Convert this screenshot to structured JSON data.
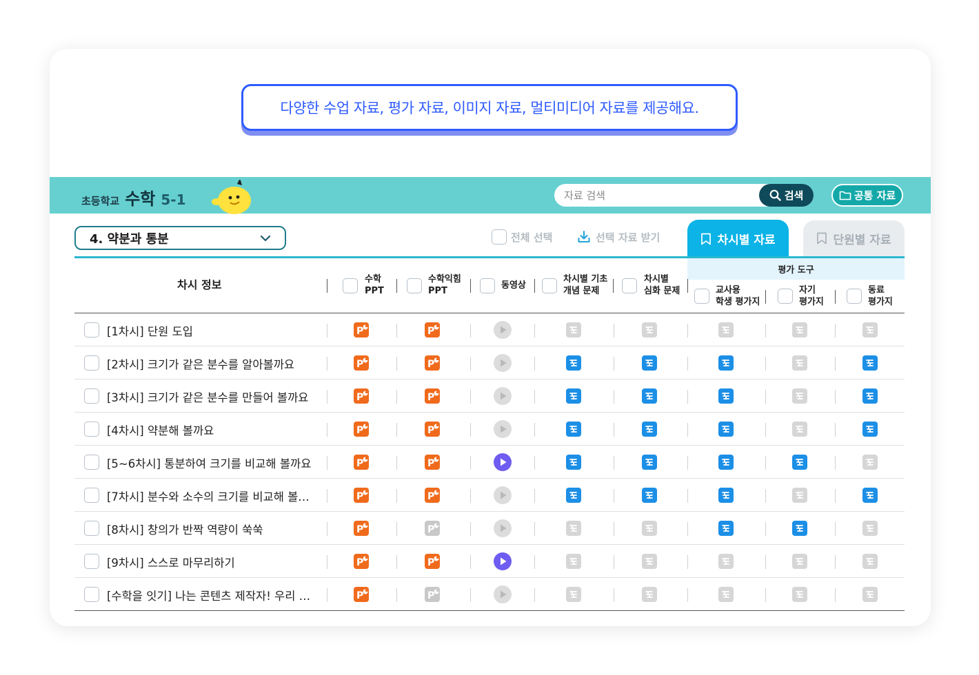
{
  "banner": {
    "text": "다양한 수업 자료, 평가 자료, 이미지 자료, 멀티미디어 자료를 제공해요."
  },
  "header": {
    "school": "초등학교",
    "subject": "수학",
    "grade": "5-1"
  },
  "search": {
    "placeholder": "자료 검색",
    "button": "검색"
  },
  "common_button": "공통 자료",
  "unit_select": {
    "value": "4. 약분과 통분"
  },
  "actions": {
    "select_all": "전체 선택",
    "download": "선택 자료 받기"
  },
  "tabs": {
    "active": "차시별 자료",
    "inactive": "단원별 자료"
  },
  "table": {
    "info_header": "차시 정보",
    "eval_group": "평가 도구",
    "columns": [
      {
        "l1": "수학",
        "l2": "PPT"
      },
      {
        "l1": "수학익힘",
        "l2": "PPT"
      },
      {
        "l1": "동영상",
        "l2": ""
      },
      {
        "l1": "차시별 기초",
        "l2": "개념 문제"
      },
      {
        "l1": "차시별",
        "l2": "심화 문제"
      },
      {
        "l1": "교사용",
        "l2": "학생 평가지"
      },
      {
        "l1": "자기",
        "l2": "평가지"
      },
      {
        "l1": "동료",
        "l2": "평가지"
      }
    ],
    "rows": [
      {
        "title": "[1차시] 단원 도입",
        "avail": [
          1,
          1,
          0,
          0,
          0,
          0,
          0,
          0
        ]
      },
      {
        "title": "[2차시] 크기가 같은 분수를 알아볼까요",
        "avail": [
          1,
          1,
          0,
          1,
          1,
          1,
          0,
          1
        ]
      },
      {
        "title": "[3차시] 크기가 같은 분수를 만들어 볼까요",
        "avail": [
          1,
          1,
          0,
          1,
          1,
          1,
          0,
          1
        ]
      },
      {
        "title": "[4차시] 약분해 볼까요",
        "avail": [
          1,
          1,
          0,
          1,
          1,
          1,
          0,
          1
        ]
      },
      {
        "title": "[5~6차시] 통분하여 크기를 비교해 볼까요",
        "avail": [
          1,
          1,
          1,
          1,
          1,
          1,
          1,
          0
        ]
      },
      {
        "title": "[7차시] 분수와 소수의 크기를 비교해 볼…",
        "avail": [
          1,
          1,
          0,
          1,
          1,
          1,
          0,
          1
        ]
      },
      {
        "title": "[8차시] 창의가 반짝 역량이 쑥쑥",
        "avail": [
          1,
          0,
          0,
          0,
          0,
          1,
          1,
          0
        ]
      },
      {
        "title": "[9차시] 스스로 마무리하기",
        "avail": [
          1,
          1,
          1,
          0,
          0,
          0,
          0,
          0
        ]
      },
      {
        "title": "[수학을 잇기] 나는 콘텐츠 제작자! 우리 …",
        "avail": [
          1,
          0,
          0,
          0,
          0,
          0,
          0,
          0
        ]
      }
    ]
  },
  "colors": {
    "teal_bar": "#66d0d0",
    "active_tab": "#0bb3e6",
    "ppt": "#f06a1c",
    "video": "#6f5cf0",
    "doc": "#1c8fe6",
    "banner": "#2e5bff"
  }
}
